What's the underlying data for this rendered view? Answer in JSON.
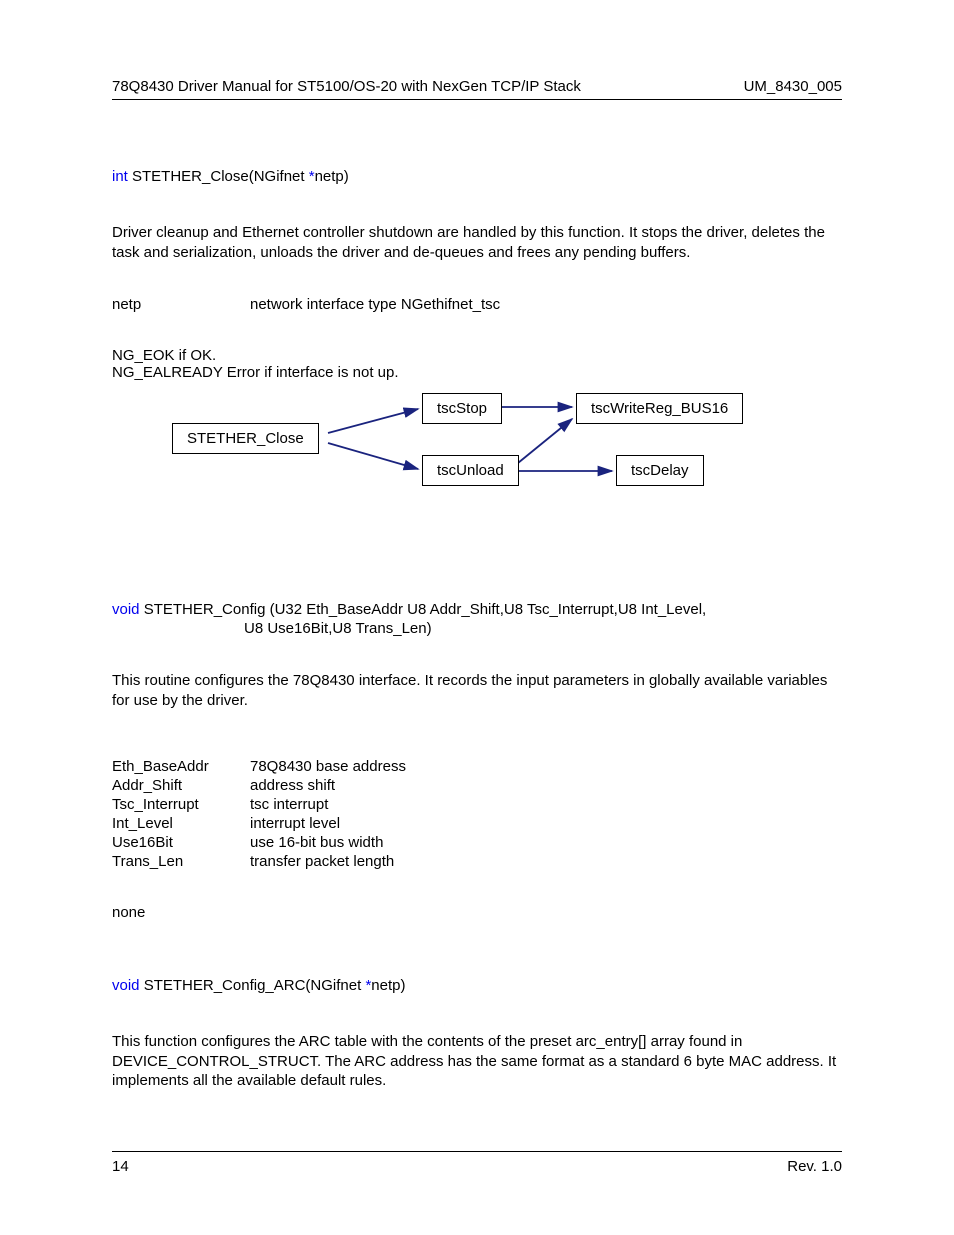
{
  "header": {
    "left": "78Q8430 Driver Manual for ST5100/OS-20 with NexGen TCP/IP Stack",
    "right": "UM_8430_005"
  },
  "close": {
    "proto_kw1": "int",
    "proto_name": " STETHER_Close(NGifnet ",
    "proto_kw2": "*",
    "proto_rest": "netp)",
    "desc": "Driver cleanup and Ethernet controller shutdown are handled by this function.  It stops the driver, deletes the task and serialization, unloads the driver and de-queues and frees any pending buffers.",
    "param_name": "netp",
    "param_desc": "network interface type NGethifnet_tsc",
    "ret1": "NG_EOK if OK.",
    "ret2": "NG_EALREADY Error if interface is not up."
  },
  "diagram": {
    "n1": "STETHER_Close",
    "n2": "tscStop",
    "n3": "tscUnload",
    "n4": "tscWriteReg_BUS16",
    "n5": "tscDelay"
  },
  "config": {
    "kw1": "void",
    "line1a": " STETHER_Config (U32 Eth_BaseAddr  U8 Addr_Shift,U8 Tsc_Interrupt,U8 Int_Level,",
    "line2": "U8 Use16Bit,U8 Trans_Len)",
    "desc": "This routine configures the 78Q8430 interface.  It records the input parameters in globally available variables for use by the driver.",
    "params": [
      {
        "n": "Eth_BaseAddr",
        "d": "78Q8430 base address"
      },
      {
        "n": "Addr_Shift",
        "d": "address shift"
      },
      {
        "n": "Tsc_Interrupt",
        "d": "tsc interrupt"
      },
      {
        "n": "Int_Level",
        "d": "interrupt level"
      },
      {
        "n": "Use16Bit",
        "d": "use 16-bit bus width"
      },
      {
        "n": "Trans_Len",
        "d": "transfer packet length"
      }
    ],
    "ret": "none"
  },
  "arc": {
    "kw1": "void",
    "proto_a": " STETHER_Config_ARC(NGifnet ",
    "kw2": "*",
    "proto_b": "netp)",
    "desc": "This function configures the ARC table with the contents of the preset arc_entry[] array found in DEVICE_CONTROL_STRUCT.  The ARC address has the same format as a standard 6 byte MAC address.  It implements all the available default rules."
  },
  "footer": {
    "left": "14",
    "right": "Rev. 1.0"
  }
}
